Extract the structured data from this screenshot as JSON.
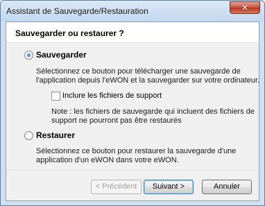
{
  "window": {
    "title": "Assistant de Sauvegarde/Restauration",
    "close_glyph": "✕"
  },
  "header": {
    "title": "Sauvegarder ou restaurer ?"
  },
  "options": {
    "backup": {
      "label": "Sauvegarder",
      "selected": true,
      "desc_line1": "Sélectionnez ce bouton pour télécharger une sauvegarde de",
      "desc_line2": "l'application depuis l'eWON et la sauvegarder sur votre ordinateur.",
      "include_support_files": {
        "label": "Inclure les fichiers de support",
        "checked": false
      },
      "note_line1": "Note : les fichiers de sauvegarde qui incluent des fichiers de",
      "note_line2": "support ne pourront pas être restaurés"
    },
    "restore": {
      "label": "Restaurer",
      "selected": false,
      "desc_line1": "Sélectionnez ce bouton pour restaurer la sauvegarde d'une",
      "desc_line2": "application d'un eWON dans votre eWON."
    }
  },
  "buttons": {
    "previous": "< Précédent",
    "next": "Suivant >",
    "cancel": "Annuler"
  },
  "colors": {
    "frame": "#cfe0f1",
    "client": "#f0f0f0",
    "close": "#c4513a",
    "accent": "#1b57b8"
  }
}
